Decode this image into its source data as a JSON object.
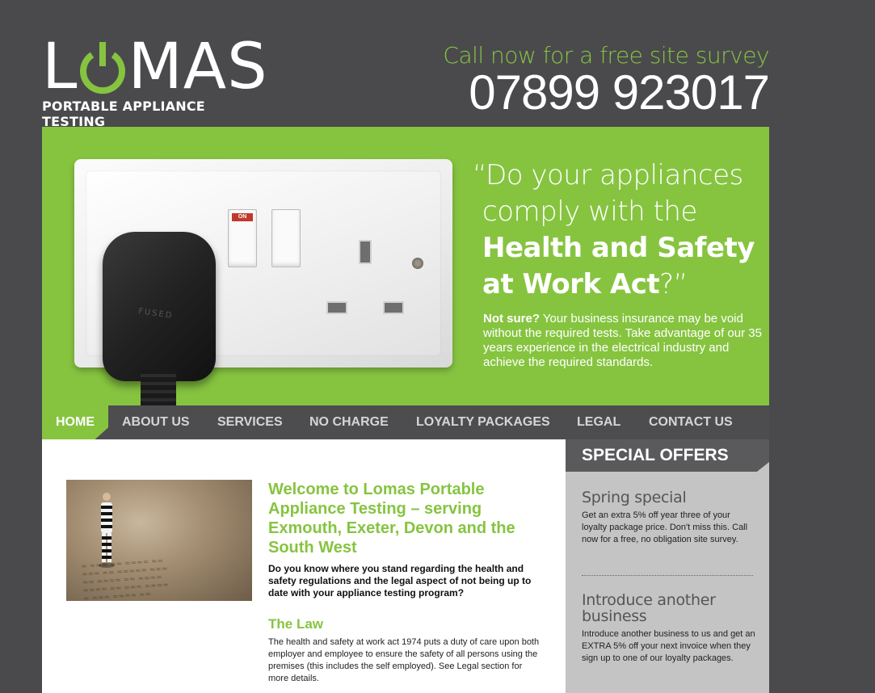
{
  "logo": {
    "word_left": "L",
    "word_right": "MAS",
    "subtitle": "PORTABLE APPLIANCE TESTING"
  },
  "header": {
    "call_line": "Call now for a free site survey",
    "phone": "07899 923017"
  },
  "hero": {
    "quote_open": "“Do your appliances",
    "quote_line2": "comply with the",
    "quote_bold1": "Health and Safety",
    "quote_bold2": "at Work Act",
    "quote_close": "?”",
    "body_bold": "Not sure?",
    "body_text": " Your business insurance may be void without the required tests. Take advantage of our 35 years experience in the electrical industry and achieve the required standards.",
    "socket_switch_label": "ON",
    "plug_label": "FUSED"
  },
  "nav": {
    "items": [
      {
        "label": "HOME",
        "active": true
      },
      {
        "label": "ABOUT US"
      },
      {
        "label": "SERVICES"
      },
      {
        "label": "NO CHARGE"
      },
      {
        "label": "LOYALTY PACKAGES"
      },
      {
        "label": "LEGAL"
      },
      {
        "label": "CONTACT US"
      }
    ]
  },
  "main": {
    "welcome_title": "Welcome to Lomas Portable Appliance Testing – serving Exmouth, Exeter, Devon and the South West",
    "intro": "Do you know where you stand regarding the health and safety regulations and the legal aspect of not being up to date with your appliance testing program?",
    "law_heading": "The Law",
    "law_text": "The health and safety at work act 1974 puts a duty of care upon both employer and employee to ensure the safety of all persons using the premises (this includes the self employed). See Legal section for more details."
  },
  "sidebar": {
    "heading": "SPECIAL OFFERS",
    "offers": [
      {
        "title": "Spring special",
        "text": "Get an extra 5% off year three of your loyalty package price. Don't miss this. Call now for a free, no obligation site survey."
      },
      {
        "title": "Introduce another business",
        "text": "Introduce another business to us and get an EXTRA 5% off your next invoice when they sign up to one of our loyalty packages."
      }
    ]
  },
  "colors": {
    "brand_green": "#86c440",
    "background": "#4a4a4d",
    "nav_bg": "#4d4d4f",
    "sidebar_bg": "#c4c4c4"
  }
}
